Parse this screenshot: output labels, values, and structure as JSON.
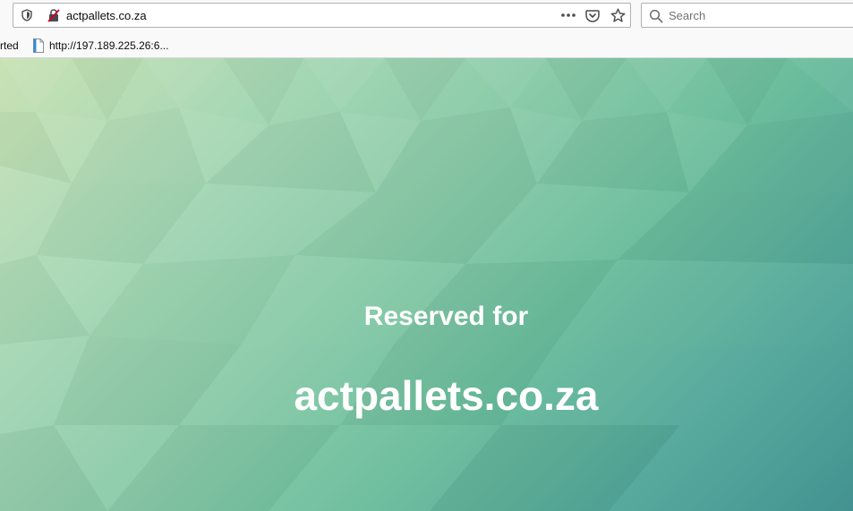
{
  "address_bar": {
    "url": "actpallets.co.za",
    "site_info_icon": "shield-icon",
    "connection_icon": "insecure-lock-icon",
    "page_actions_icon": "more-icon",
    "pocket_icon": "pocket-icon",
    "bookmark_icon": "star-icon"
  },
  "search_bar": {
    "placeholder": "Search",
    "icon": "search-icon"
  },
  "bookmarks": {
    "items": [
      {
        "label": "rted"
      },
      {
        "label": "http://197.189.225.26:6...",
        "icon": "page-icon"
      }
    ]
  },
  "page": {
    "heading": "Reserved for",
    "domain": "actpallets.co.za"
  },
  "colors": {
    "gradient_start": "#c9e2b4",
    "gradient_end": "#3d8f8e",
    "text": "#ffffff"
  }
}
